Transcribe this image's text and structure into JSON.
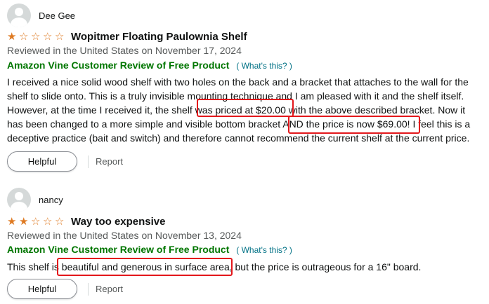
{
  "reviews": [
    {
      "profile_name": "Dee Gee",
      "stars": [
        "★",
        "☆",
        "☆",
        "☆",
        "☆"
      ],
      "rating": 1,
      "title": "Wopitmer Floating Paulownia Shelf",
      "meta": "Reviewed in the United States on November 17, 2024",
      "vine_label": "Amazon Vine Customer Review of Free Product",
      "vine_help": "What's this?",
      "body_lines": [
        "I received a nice solid wood shelf with two holes on the back and a bracket that attaches to the wall for the",
        "shelf to slide onto. This is a truly invisible mounting technique and I am pleased with it and the shelf itself.",
        "However, at the time I received it, the shelf was priced at $20.00 with the above described bracket. Now it",
        "has been changed to a more simple and visible bottom bracket AND the price is now $69.00! I feel this is a",
        "deceptive practice (bait and switch) and therefore cannot recommend the current shelf at the current price."
      ],
      "helpful_label": "Helpful",
      "report_label": "Report"
    },
    {
      "profile_name": "nancy",
      "stars": [
        "★",
        "★",
        "☆",
        "☆",
        "☆"
      ],
      "rating": 2,
      "title": "Way too expensive",
      "meta": "Reviewed in the United States on November 13, 2024",
      "vine_label": "Amazon Vine Customer Review of Free Product",
      "vine_help": "What's this?",
      "body_lines": [
        "This shelf is beautiful and generous in surface area, but the price is outrageous for a 16\" board."
      ],
      "helpful_label": "Helpful",
      "report_label": "Report"
    }
  ],
  "colors": {
    "star": "#de7921",
    "vine": "#007600",
    "link": "#007185",
    "highlight": "#e3171b"
  }
}
